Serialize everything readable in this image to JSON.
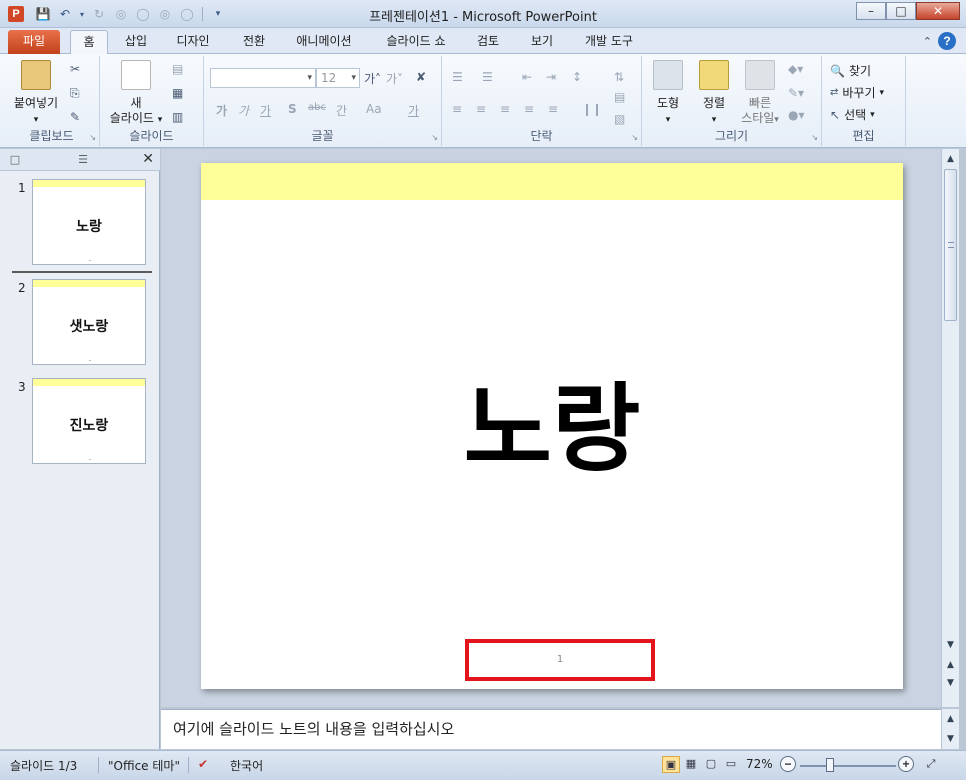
{
  "window": {
    "title": "프레젠테이션1 - Microsoft PowerPoint",
    "app_icon": "P"
  },
  "qat": {
    "icons": [
      "save-icon",
      "undo-icon",
      "redo-icon",
      "customize-icon"
    ]
  },
  "tabs": [
    "파일",
    "홈",
    "삽입",
    "디자인",
    "전환",
    "애니메이션",
    "슬라이드 쇼",
    "검토",
    "보기",
    "개발 도구"
  ],
  "active_tab": "홈",
  "ribbon": {
    "clipboard": {
      "label": "클립보드",
      "paste": "붙여넣기"
    },
    "slides": {
      "label": "슬라이드",
      "new_slide": "새",
      "new_slide_2": "슬라이드"
    },
    "font": {
      "label": "글꼴",
      "font_size": "12",
      "bold": "가",
      "italic": "가",
      "underline": "가",
      "strike": "abc",
      "spacing": "간",
      "case": "Aa",
      "color": "가"
    },
    "paragraph": {
      "label": "단락"
    },
    "drawing": {
      "label": "그리기",
      "shapes": "도형",
      "arrange": "정렬",
      "quick_styles": "빠른",
      "quick_styles_2": "스타일"
    },
    "editing": {
      "label": "편집",
      "find": "찾기",
      "replace": "바꾸기",
      "select": "선택"
    }
  },
  "thumbnails": [
    {
      "num": "1",
      "title": "노랑"
    },
    {
      "num": "2",
      "title": "샛노랑"
    },
    {
      "num": "3",
      "title": "진노랑"
    }
  ],
  "slide": {
    "title": "노랑",
    "number": "1",
    "band_color": "#ffff99"
  },
  "notes": {
    "text": "여기에 슬라이드 노트의 내용을 입력하십시오"
  },
  "status": {
    "slide_info": "슬라이드 1/3",
    "theme": "\"Office 테마\"",
    "language": "한국어",
    "zoom": "72%"
  }
}
